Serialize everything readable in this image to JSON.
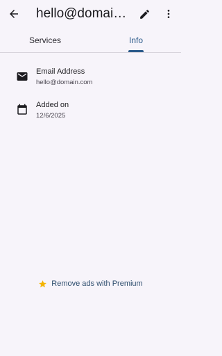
{
  "appbar": {
    "title": "hello@domain.com",
    "back_icon": "arrow-back-icon",
    "edit_icon": "pencil-icon",
    "more_icon": "more-vertical-icon"
  },
  "tabs": [
    {
      "label": "Services",
      "selected": false
    },
    {
      "label": "Info",
      "selected": true
    }
  ],
  "details": {
    "email": {
      "label": "Email Address",
      "value": "hello@domain.com",
      "icon": "email-icon"
    },
    "added": {
      "label": "Added on",
      "value": "12/6/2025",
      "icon": "calendar-icon"
    }
  },
  "promo": {
    "label": "Remove ads with Premium",
    "icon": "star-icon"
  },
  "colors": {
    "background": "#f7f4fa",
    "accent": "#2b5a8a",
    "star": "#f4b400",
    "promo_text": "#2a4a6b"
  }
}
